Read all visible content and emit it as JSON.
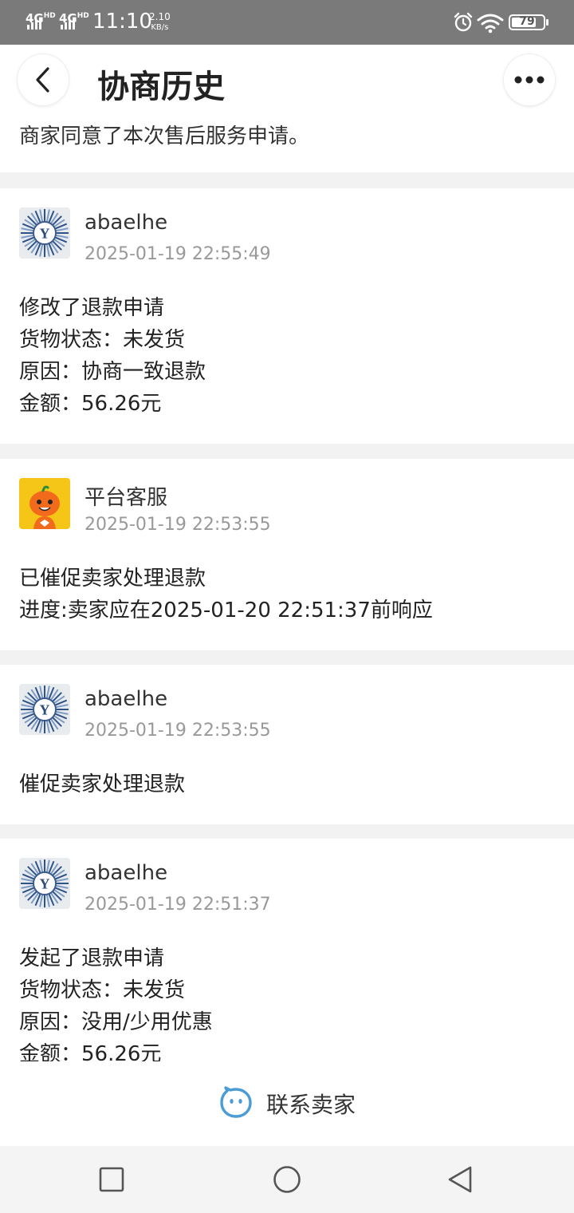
{
  "status_bar": {
    "network_1": "4G",
    "network_1_sup": "HD",
    "network_2": "4G",
    "network_2_sup": "HD",
    "time": "11:10",
    "speed_value": "2.10",
    "speed_unit": "KB/s",
    "battery": "79",
    "battery_level": 0.79
  },
  "header": {
    "title": "协商历史",
    "notice": "商家同意了本次售后服务申请。"
  },
  "records": [
    {
      "author": "abaelhe",
      "time": "2025-01-19 22:55:49",
      "lines": [
        "修改了退款申请",
        "货物状态：未发货",
        "原因：协商一致退款",
        "金额：56.26元"
      ]
    },
    {
      "author": "平台客服",
      "time": "2025-01-19 22:53:55",
      "lines": [
        "已催促卖家处理退款",
        "进度:卖家应在2025-01-20 22:51:37前响应"
      ]
    },
    {
      "author": "abaelhe",
      "time": "2025-01-19 22:53:55",
      "lines": [
        "催促卖家处理退款"
      ]
    },
    {
      "author": "abaelhe",
      "time": "2025-01-19 22:51:37",
      "lines": [
        "发起了退款申请",
        "货物状态：未发货",
        "原因：没用/少用优惠",
        "金额：56.26元"
      ]
    }
  ],
  "footer": {
    "contact_label": "联系卖家"
  },
  "colors": {
    "status_bar_bg": "#7a7a7a",
    "accent_blue": "#4a9bd6",
    "muted_text": "#999999"
  },
  "icons": {
    "back": "chevron-left-icon",
    "more": "more-dots-icon",
    "contact": "chat-bubble-icon",
    "nav_recent": "square-icon",
    "nav_home": "circle-icon",
    "nav_back": "triangle-back-icon"
  }
}
